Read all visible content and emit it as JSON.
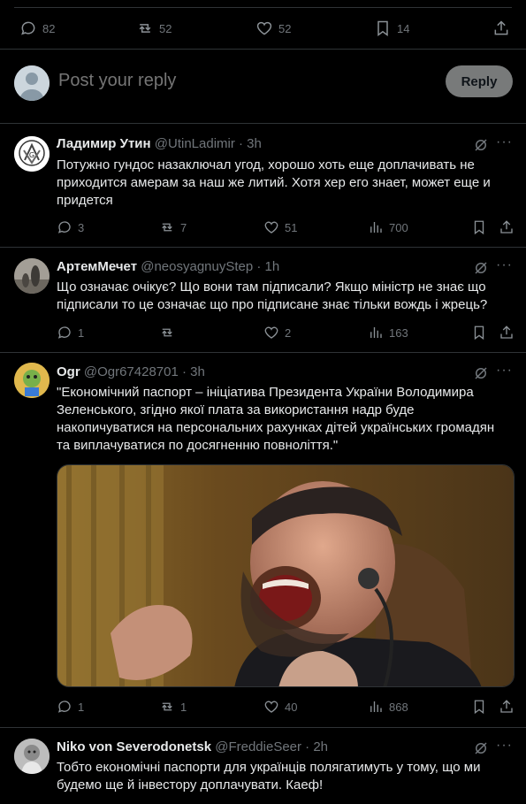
{
  "top_stats": {
    "replies": "82",
    "reposts": "52",
    "likes": "52",
    "bookmarks": "14"
  },
  "reply_box": {
    "placeholder": "Post your reply",
    "button_label": "Reply"
  },
  "tweets": [
    {
      "name": "Ладимир Утин",
      "handle": "@UtinLadimir · 3h",
      "text": "Потужно гундос назаключал угод, хорошо хоть еще доплачивать не приходится амерам за наш же литий. Хотя хер его знает, может еще и придется",
      "replies": "3",
      "reposts": "7",
      "likes": "51",
      "views": "700"
    },
    {
      "name": "АртемМечет",
      "handle": "@neosyagnuyStep · 1h",
      "text": "Що означає очікує? Що вони там підписали? Якщо міністр не знає що підписали то це означає що про підписане знає тільки вождь і жрець?",
      "replies": "1",
      "reposts": "",
      "likes": "2",
      "views": "163"
    },
    {
      "name": "Ogr",
      "handle": "@Ogr67428701 · 3h",
      "text": "\"Економічний паспорт – ініціатива Президента України Володимира Зеленського, згідно якої плата за використання надр буде накопичуватися на персональних рахунках дітей українських громадян та виплачуватися по досягненню повноліття.\"",
      "replies": "1",
      "reposts": "1",
      "likes": "40",
      "views": "868"
    },
    {
      "name": "Niko von Severodonetsk",
      "handle": "@FreddieSeer · 2h",
      "text": "Тобто економічні паспорти для українців полягатимуть у тому, що ми будемо ще й інвестору доплачувати. Каеф!"
    }
  ],
  "more_glyph": "···"
}
